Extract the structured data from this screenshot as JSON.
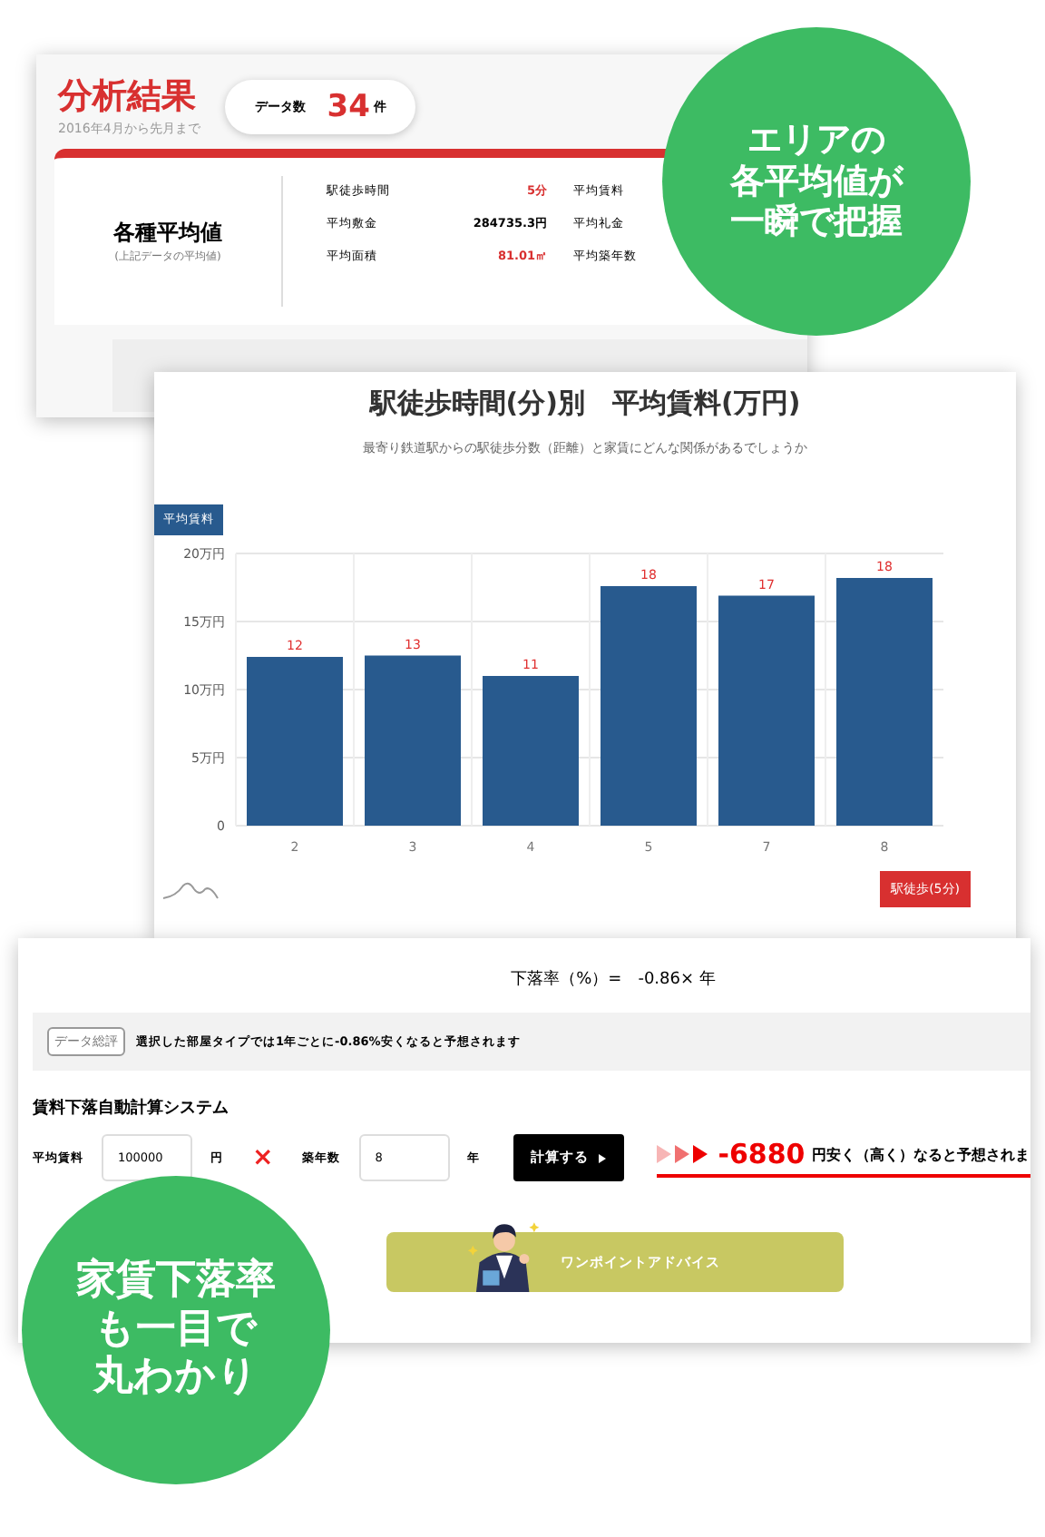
{
  "summary_card": {
    "title": "分析結果",
    "period": "2016年4月から先月まで",
    "data_count": {
      "label": "データ数",
      "value": "34",
      "unit": "件"
    },
    "averages": {
      "heading": "各種平均値",
      "note": "(上記データの平均値)",
      "stats": [
        {
          "label": "駅徒歩時間",
          "value": "5分",
          "highlight": true
        },
        {
          "label": "平均敷金",
          "value": "284735.3円",
          "highlight": false
        },
        {
          "label": "平均面積",
          "value": "81.01㎡",
          "highlight": true
        }
      ],
      "more_labels": [
        "平均賃料",
        "平均礼金",
        "平均築年数"
      ]
    }
  },
  "chart_card": {
    "title": "駅徒歩時間(分)別　平均賃料(万円)",
    "subtitle": "最寄り鉄道駅からの駅徒歩分数（距離）と家賃にどんな関係があるでしょうか",
    "chart_data": {
      "type": "bar",
      "grid": true,
      "categories": [
        "2",
        "3",
        "4",
        "5",
        "7",
        "8"
      ],
      "series": [
        {
          "name": "平均賃料",
          "color": "#285a8e",
          "values": [
            12.4,
            12.5,
            11,
            17.6,
            16.9,
            18.2
          ]
        }
      ],
      "value_labels": [
        "12",
        "13",
        "11",
        "18",
        "17",
        "18"
      ],
      "ylim": [
        0,
        20
      ],
      "yticks": [
        {
          "value": 0,
          "label": "0"
        },
        {
          "value": 5,
          "label": "5万円"
        },
        {
          "value": 10,
          "label": "10万円"
        },
        {
          "value": 15,
          "label": "15万円"
        },
        {
          "value": 20,
          "label": "20万円"
        }
      ]
    },
    "button": "駅徒歩(5分)"
  },
  "calc_card": {
    "formula": "下落率（%）=　-0.86× 年",
    "comment": {
      "badge": "データ総評",
      "text": "選択した部屋タイプでは1年ごとに-0.86%安くなると予想されます"
    },
    "heading": "賃料下落自動計算システム",
    "inputs": [
      {
        "label": "平均賃料",
        "value": "100000",
        "unit": "円"
      },
      {
        "label": "築年数",
        "value": "8",
        "unit": "年"
      }
    ],
    "operator": "×",
    "button": "計算する",
    "result": {
      "amount": "-6880",
      "text": "円安く（高く）なると予想されま"
    },
    "advice_button": "ワンポイントアドバイス"
  },
  "callouts": [
    {
      "lines": [
        "エリアの",
        "各平均値が",
        "一瞬で把握"
      ]
    },
    {
      "lines": [
        "家賃下落率",
        "も一目で",
        "丸わかり"
      ]
    }
  ]
}
